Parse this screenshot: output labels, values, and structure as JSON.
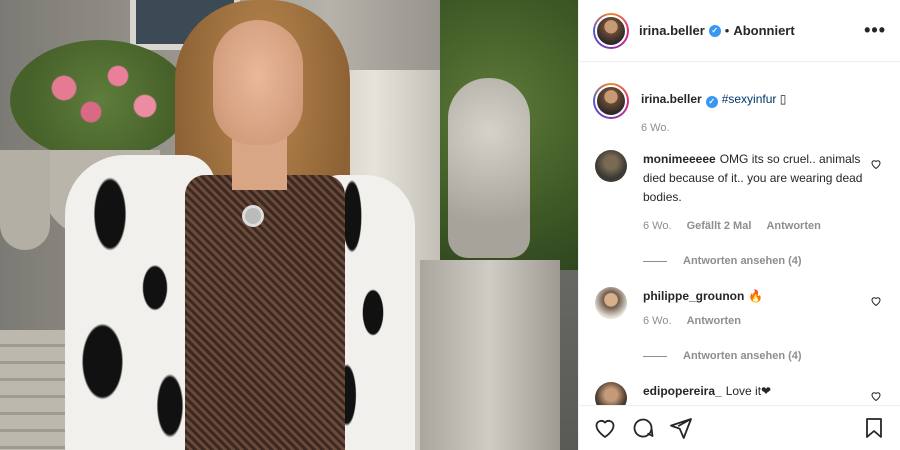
{
  "post": {
    "username": "irina.beller",
    "verified_icon": "verified-icon",
    "separator": "•",
    "follow_status": "Abonniert",
    "more_icon": "more-options-icon"
  },
  "caption": {
    "username": "irina.beller",
    "hashtag": "#sexyinfur",
    "trailing_glyph": "▯",
    "time": "6 Wo."
  },
  "comments": [
    {
      "username": "monimeeeee",
      "text": "OMG its so cruel.. animals died because of it.. you are wearing dead bodies.",
      "time": "6 Wo.",
      "likes": "Gefällt 2 Mal",
      "reply": "Antworten",
      "view_replies": "Antworten ansehen (4)"
    },
    {
      "username": "philippe_grounon",
      "text": "🔥",
      "time": "6 Wo.",
      "reply": "Antworten",
      "view_replies": "Antworten ansehen (4)"
    },
    {
      "username": "edipopereira_",
      "text": "Love it❤"
    }
  ],
  "actions": {
    "like": "heart-icon",
    "comment": "comment-icon",
    "share": "share-icon",
    "save": "bookmark-icon"
  },
  "colors": {
    "link": "#00376b",
    "muted": "#8e8e8e",
    "verified": "#3897f0",
    "text": "#262626"
  }
}
